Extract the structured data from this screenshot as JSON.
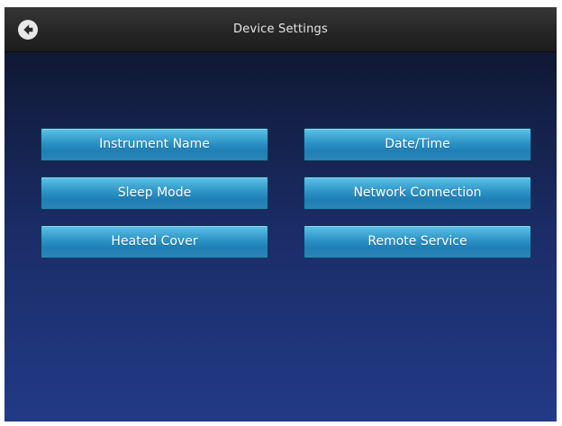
{
  "header": {
    "title": "Device Settings",
    "back_icon": "arrow-left-circle-icon"
  },
  "buttons": [
    {
      "label": "Instrument Name"
    },
    {
      "label": "Date/Time"
    },
    {
      "label": "Sleep Mode"
    },
    {
      "label": "Network Connection"
    },
    {
      "label": "Heated Cover"
    },
    {
      "label": "Remote Service"
    }
  ],
  "colors": {
    "button_top": "#5cc2e8",
    "button_bottom": "#1f7fb4",
    "background_top": "#0c1426",
    "background_bottom": "#223a86",
    "titlebar": "#262626"
  }
}
